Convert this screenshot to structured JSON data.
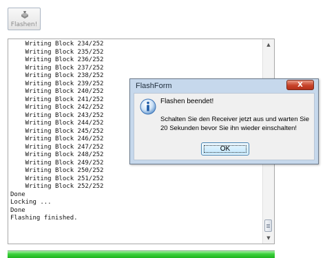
{
  "toolbar": {
    "flash_label": "Flashen!"
  },
  "log": {
    "lines": [
      "    Writing Block 234/252",
      "    Writing Block 235/252",
      "    Writing Block 236/252",
      "    Writing Block 237/252",
      "    Writing Block 238/252",
      "    Writing Block 239/252",
      "    Writing Block 240/252",
      "    Writing Block 241/252",
      "    Writing Block 242/252",
      "    Writing Block 243/252",
      "    Writing Block 244/252",
      "    Writing Block 245/252",
      "    Writing Block 246/252",
      "    Writing Block 247/252",
      "    Writing Block 248/252",
      "    Writing Block 249/252",
      "    Writing Block 250/252",
      "    Writing Block 251/252",
      "    Writing Block 252/252",
      "Done",
      "Locking ...",
      "Done",
      "Flashing finished."
    ]
  },
  "progress": {
    "value_percent": 100,
    "color": "#2cc62c"
  },
  "dialog": {
    "title": "FlashForm",
    "close_label": "X",
    "message_title": "Flashen beendet!",
    "message_body": "Schalten Sie den Receiver jetzt aus und warten Sie 20 Sekunden bevor Sie ihn wieder einschalten!",
    "ok_label": "OK",
    "icon": "info-icon"
  }
}
